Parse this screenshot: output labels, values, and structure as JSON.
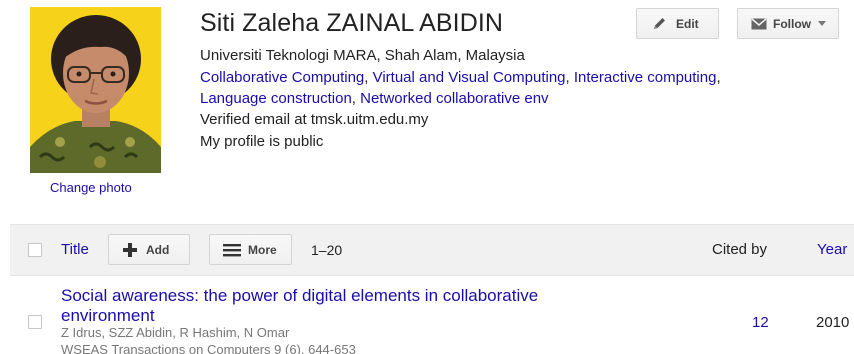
{
  "profile": {
    "name": "Siti Zaleha ZAINAL ABIDIN",
    "affiliation": "Universiti Teknologi MARA, Shah Alam, Malaysia",
    "interests": [
      "Collaborative Computing",
      "Virtual and Visual Computing",
      "Interactive computing",
      "Language construction",
      "Networked collaborative env"
    ],
    "separator": ", ",
    "verified_email": "Verified email at tmsk.uitm.edu.my",
    "visibility": "My profile is public",
    "change_photo_label": "Change photo",
    "photo_background": "#f7d21a"
  },
  "actions": {
    "edit_label": "Edit",
    "follow_label": "Follow"
  },
  "toolbar": {
    "title_label": "Title",
    "add_label": "Add",
    "more_label": "More",
    "range": "1–20",
    "cited_by_label": "Cited by",
    "year_label": "Year"
  },
  "publications": [
    {
      "title": "Social awareness: the power of digital elements in collaborative environment",
      "authors": "Z Idrus, SZZ Abidin, R Hashim, N Omar",
      "venue": "WSEAS Transactions on Computers 9 (6), 644-653",
      "cited_by": "12",
      "year": "2010"
    }
  ],
  "colors": {
    "link": "#1a0dab",
    "text": "#222222",
    "muted": "#777777",
    "toolbar_bg": "#f1f1f1"
  }
}
